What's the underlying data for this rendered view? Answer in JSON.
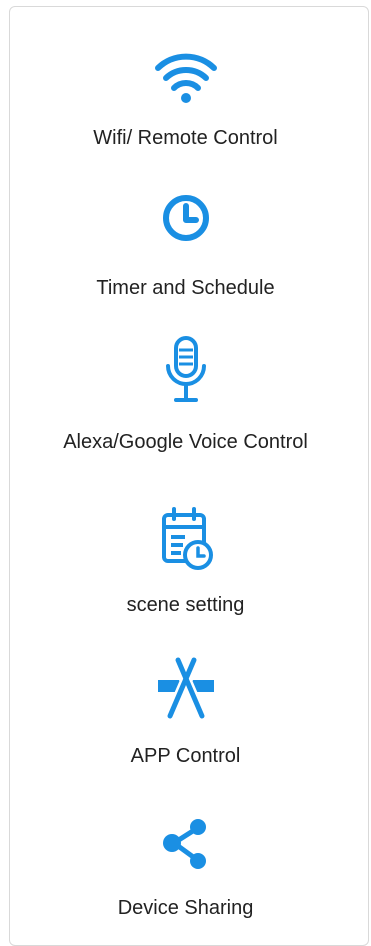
{
  "accent_color": "#1a8fe3",
  "features": [
    {
      "icon": "wifi-icon",
      "label": "Wifi/ Remote Control"
    },
    {
      "icon": "clock-icon",
      "label": "Timer and Schedule"
    },
    {
      "icon": "microphone-icon",
      "label": "Alexa/Google Voice Control"
    },
    {
      "icon": "calendar-clock-icon",
      "label": "scene setting"
    },
    {
      "icon": "app-store-icon",
      "label": "APP Control"
    },
    {
      "icon": "share-icon",
      "label": "Device Sharing"
    }
  ]
}
